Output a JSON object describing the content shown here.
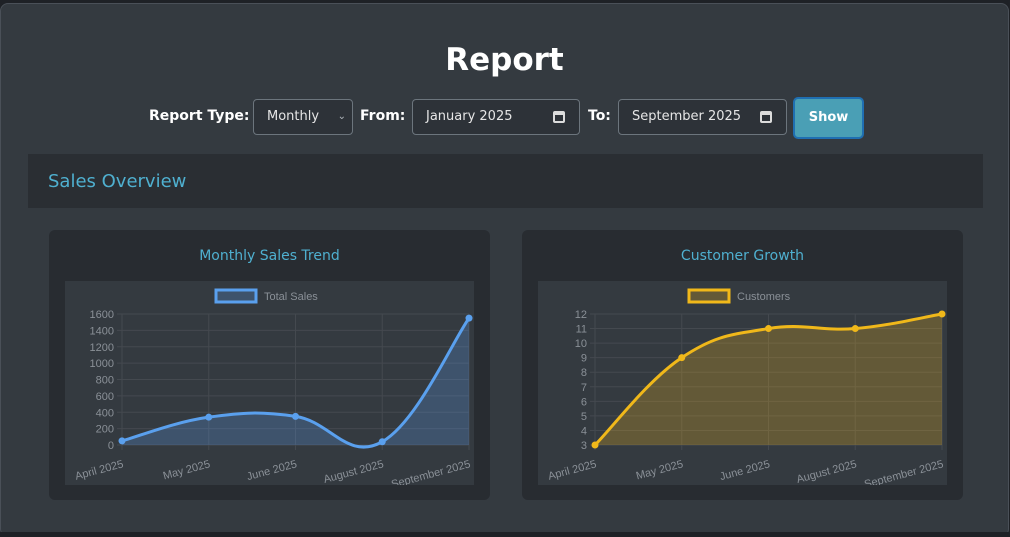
{
  "page": {
    "title": "Report"
  },
  "filters": {
    "report_type_label": "Report Type:",
    "report_type_value": "Monthly",
    "from_label": "From:",
    "from_value": "January 2025",
    "to_label": "To:",
    "to_value": "September 2025",
    "show_button": "Show"
  },
  "section": {
    "title": "Sales Overview"
  },
  "colors": {
    "accent": "#4fb0d0",
    "button": "#4a9fb5",
    "sales_line": "#5aa0ee",
    "customers_line": "#f0b81a"
  },
  "chart_data": [
    {
      "type": "line",
      "title": "Monthly Sales Trend",
      "categories": [
        "April 2025",
        "May 2025",
        "June 2025",
        "August 2025",
        "September 2025"
      ],
      "series": [
        {
          "name": "Total Sales",
          "values": [
            50,
            340,
            350,
            40,
            1550
          ]
        }
      ],
      "ylim": [
        0,
        1600
      ],
      "yticks": [
        0,
        200,
        400,
        600,
        800,
        1000,
        1200,
        1400,
        1600
      ],
      "legend": "top",
      "grid": true,
      "fill": true
    },
    {
      "type": "line",
      "title": "Customer Growth",
      "categories": [
        "April 2025",
        "May 2025",
        "June 2025",
        "August 2025",
        "September 2025"
      ],
      "series": [
        {
          "name": "Customers",
          "values": [
            3,
            9,
            11,
            11,
            12
          ]
        }
      ],
      "ylim": [
        3,
        12
      ],
      "yticks": [
        3,
        4,
        5,
        6,
        7,
        8,
        9,
        10,
        11,
        12
      ],
      "legend": "top",
      "grid": true,
      "fill": true
    }
  ]
}
